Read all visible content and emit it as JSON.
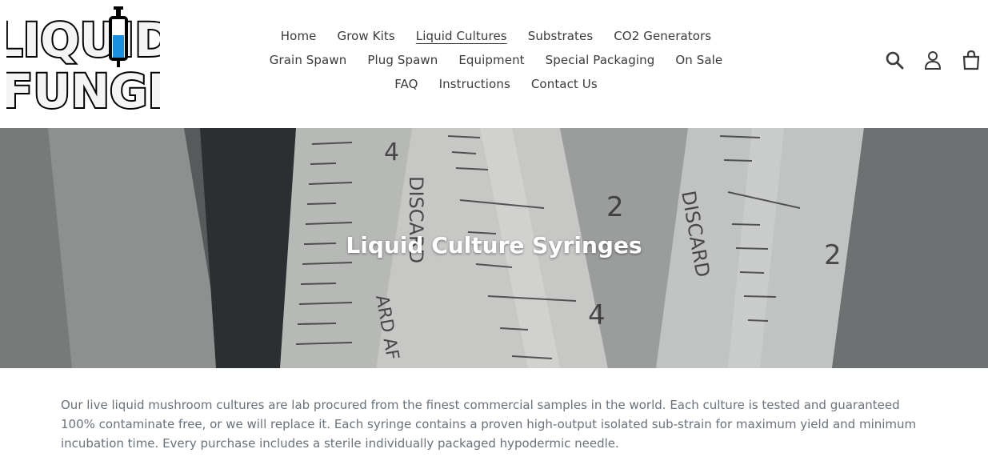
{
  "logo": {
    "line1": "LIQUID",
    "line2": "FUNGI",
    "alt_icon": "syringe-icon"
  },
  "nav": {
    "rows": [
      [
        {
          "label": "Home"
        },
        {
          "label": "Grow Kits"
        },
        {
          "label": "Liquid Cultures",
          "active": true
        },
        {
          "label": "Substrates"
        },
        {
          "label": "CO2 Generators"
        }
      ],
      [
        {
          "label": "Grain Spawn"
        },
        {
          "label": "Plug Spawn"
        },
        {
          "label": "Equipment"
        },
        {
          "label": "Special Packaging"
        },
        {
          "label": "On Sale"
        }
      ],
      [
        {
          "label": "FAQ"
        },
        {
          "label": "Instructions"
        },
        {
          "label": "Contact Us"
        }
      ]
    ]
  },
  "header_icons": [
    "search-icon",
    "account-icon",
    "cart-icon"
  ],
  "hero": {
    "title": "Liquid Culture Syringes",
    "image_text": [
      "4",
      "DISCARD",
      "2",
      "4",
      "DISCARD",
      "2",
      "ARD AF"
    ]
  },
  "description": "Our live liquid mushroom cultures are lab procured from the finest commercial samples in the world. Each culture is tested and guaranteed 100% contaminate free, or we will replace it. Each syringe contains a proven high-output isolated sub-strain for maximum yield and minimum incubation time. Every purchase includes a sterile individually packaged hypodermic needle.",
  "colors": {
    "accent_blue": "#1b8fe0",
    "text": "#3a3a3a",
    "muted_text": "#69727b"
  }
}
